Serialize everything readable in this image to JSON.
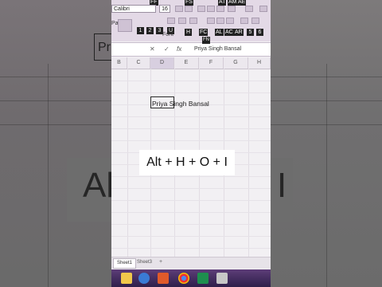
{
  "ribbon": {
    "font_name": "Calibri",
    "font_size": "16",
    "paste_label": "Paster",
    "font_group_label": "Font",
    "keytips_row1": [
      "FF",
      "FS",
      "AT",
      "AM",
      "AE"
    ],
    "keytips_row2": [
      "1",
      "2",
      "3",
      "U",
      "H",
      "FC",
      "AL",
      "AC",
      "AR",
      "5",
      "6"
    ]
  },
  "formula_bar": {
    "fx_label": "fx",
    "keytip": "FN",
    "value": "Priya Singh Bansal"
  },
  "columns": [
    "B",
    "C",
    "D",
    "E",
    "F",
    "G",
    "H"
  ],
  "active_column": "D",
  "cell": {
    "text": "Priya Singh Bansal"
  },
  "sheets": [
    "Sheet1",
    "Sheet3"
  ],
  "caption": {
    "text": "Alt + H + O + I"
  },
  "background": {
    "caption_left": "Al",
    "caption_right": "I",
    "cell_text": "Pr"
  }
}
